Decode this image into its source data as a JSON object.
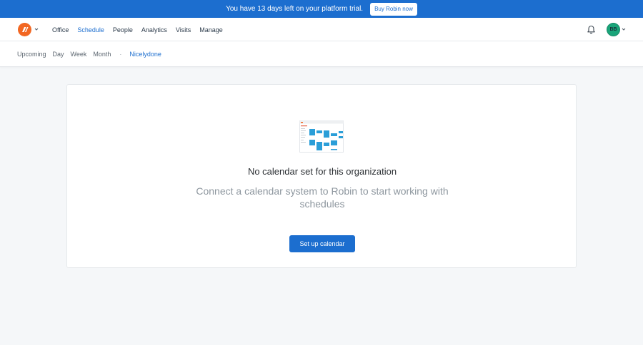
{
  "banner": {
    "text": "You have 13 days left on your platform trial.",
    "button_label": "Buy Robin now"
  },
  "nav": {
    "logo_icon": "robin-logo-icon",
    "items": [
      {
        "label": "Office",
        "active": false
      },
      {
        "label": "Schedule",
        "active": true
      },
      {
        "label": "People",
        "active": false
      },
      {
        "label": "Analytics",
        "active": false
      },
      {
        "label": "Visits",
        "active": false
      },
      {
        "label": "Manage",
        "active": false
      }
    ],
    "notification_icon": "bell-icon",
    "avatar_initials": "BB"
  },
  "subnav": {
    "items": [
      "Upcoming",
      "Day",
      "Week",
      "Month"
    ],
    "separator": "·",
    "organization": "Nicelydone"
  },
  "empty_state": {
    "illustration_icon": "calendar-illustration-icon",
    "title": "No calendar set for this organization",
    "description": "Connect a calendar system to Robin to start working with schedules",
    "button_label": "Set up calendar"
  },
  "colors": {
    "brand_blue": "#1c6ecf",
    "logo_orange": "#f26722",
    "avatar_green": "#1aa57a",
    "background": "#f5f7f9"
  }
}
